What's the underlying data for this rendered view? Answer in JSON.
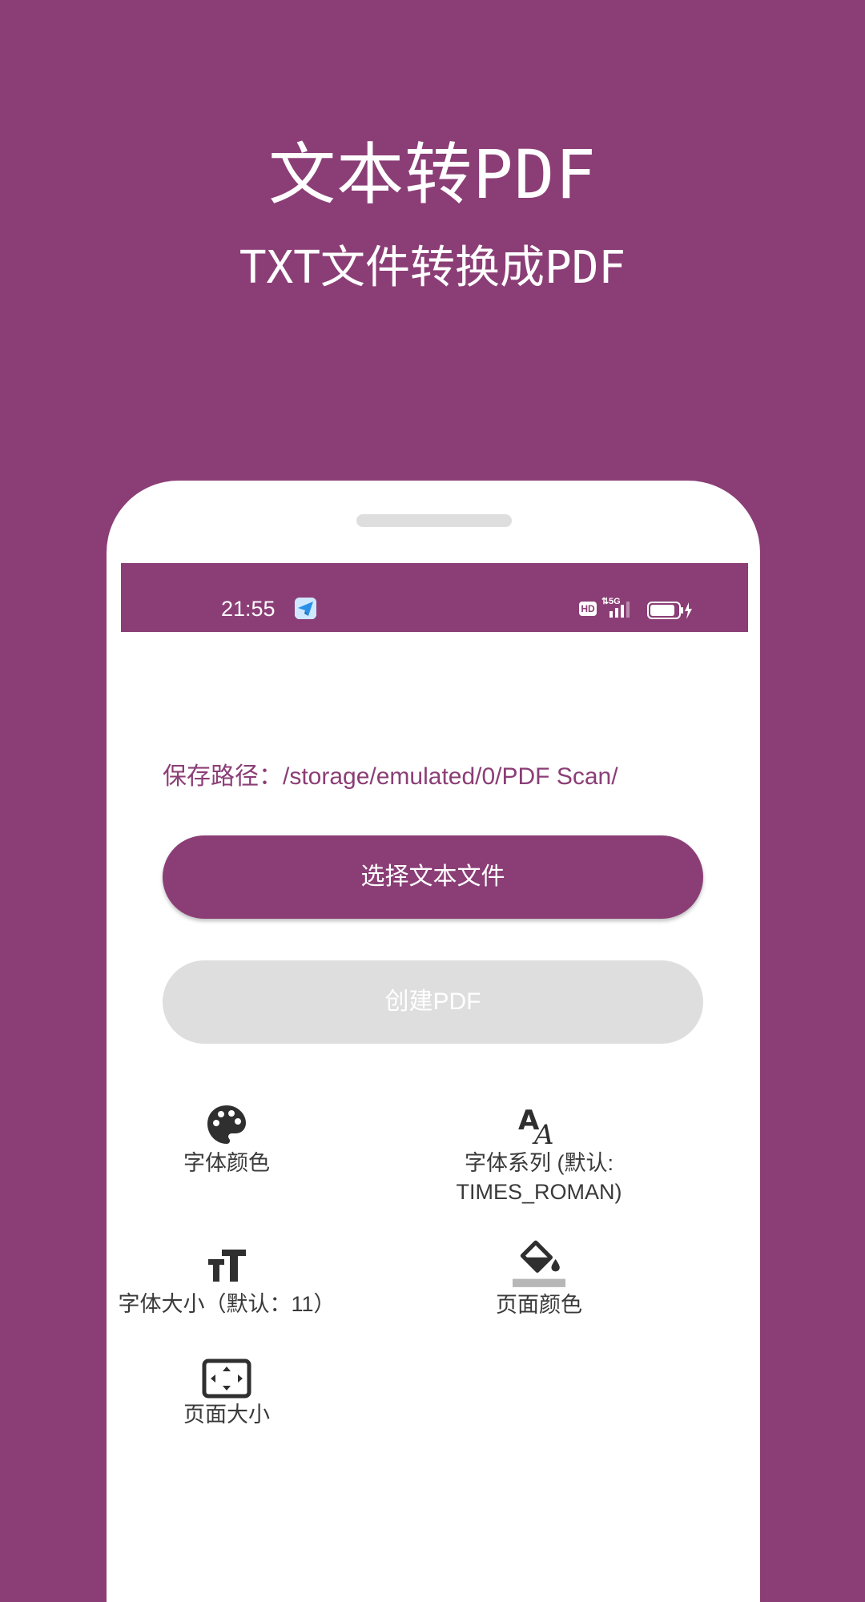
{
  "hero": {
    "title": "文本转PDF",
    "subtitle": "TXT文件转换成PDF"
  },
  "status_bar": {
    "time": "21:55",
    "hd_label": "HD",
    "network_label": "5G"
  },
  "content": {
    "save_path": "保存路径：/storage/emulated/0/PDF Scan/",
    "select_button_label": "选择文本文件",
    "create_button_label": "创建PDF"
  },
  "options": {
    "font_color": "字体颜色",
    "font_family": "字体系列 (默认:\nTIMES_ROMAN)",
    "font_size": "字体大小（默认：11）",
    "page_color": "页面颜色",
    "page_size": "页面大小"
  },
  "colors": {
    "brand": "#8b3e76",
    "disabled": "#dedede",
    "icon": "#2f2f2f"
  }
}
